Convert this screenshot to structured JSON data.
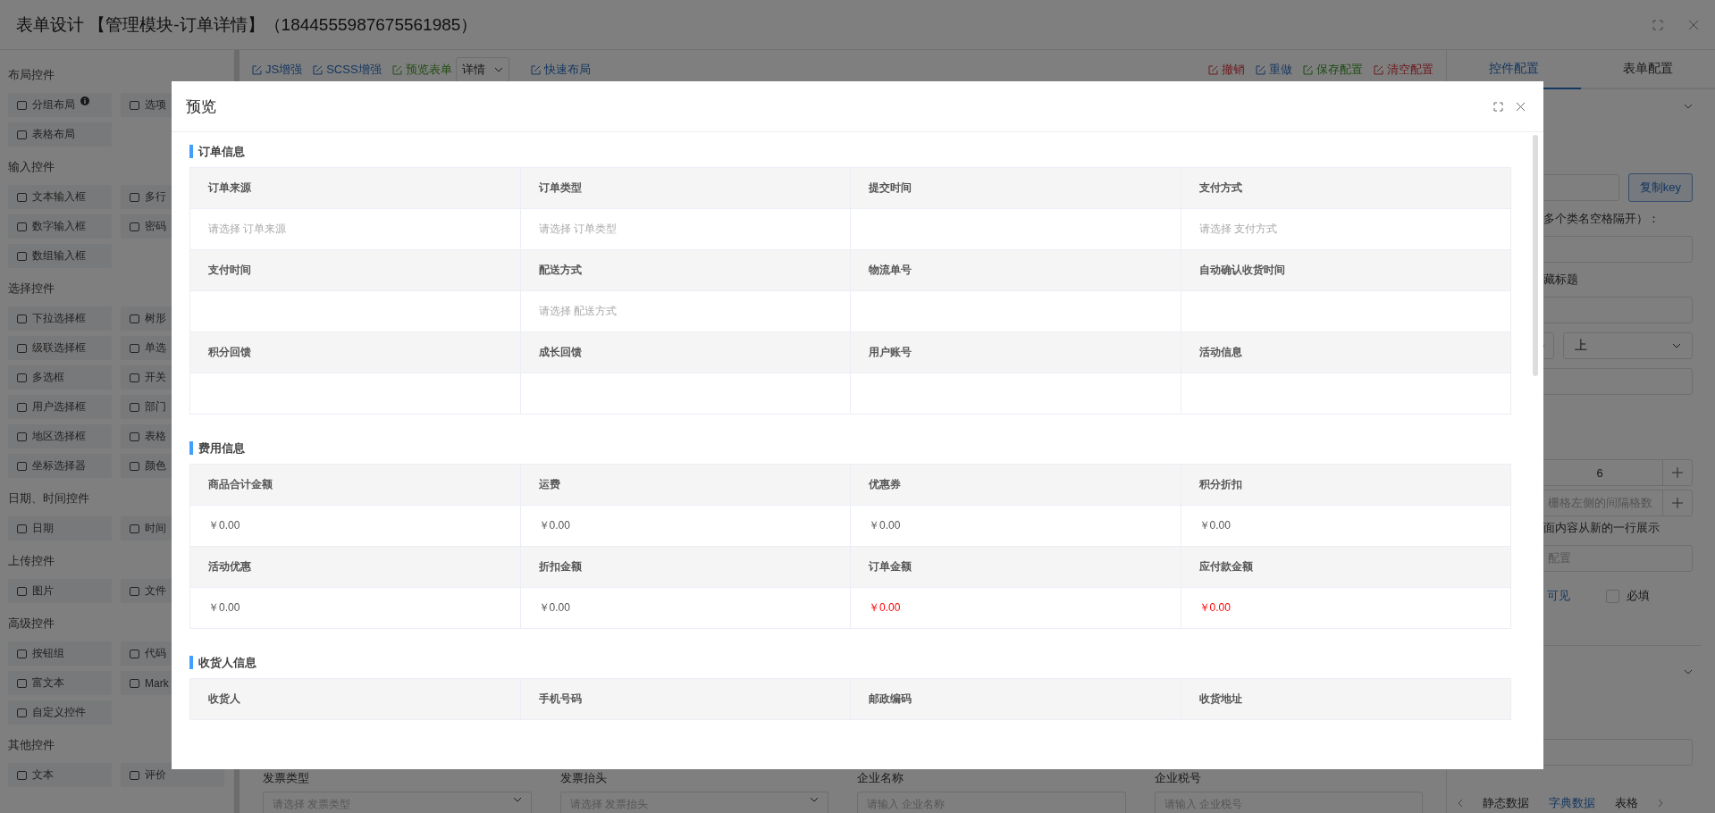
{
  "window": {
    "title": "表单设计 【管理模块-订单详情】（1844555987675561985）"
  },
  "sidebar": {
    "groups": [
      {
        "title": "布局控件",
        "items": [
          {
            "label": "分组布局",
            "info": true
          },
          {
            "label": "选项"
          },
          {
            "label": "表格布局"
          }
        ]
      },
      {
        "title": "输入控件",
        "items": [
          {
            "label": "文本输入框"
          },
          {
            "label": "多行"
          },
          {
            "label": "数字输入框"
          },
          {
            "label": "密码"
          },
          {
            "label": "数组输入框"
          }
        ]
      },
      {
        "title": "选择控件",
        "items": [
          {
            "label": "下拉选择框"
          },
          {
            "label": "树形"
          },
          {
            "label": "级联选择框"
          },
          {
            "label": "单选"
          },
          {
            "label": "多选框"
          },
          {
            "label": "开关"
          },
          {
            "label": "用户选择框"
          },
          {
            "label": "部门"
          },
          {
            "label": "地区选择框"
          },
          {
            "label": "表格"
          },
          {
            "label": "坐标选择器"
          },
          {
            "label": "颜色"
          }
        ]
      },
      {
        "title": "日期、时间控件",
        "items": [
          {
            "label": "日期"
          },
          {
            "label": "时间"
          }
        ]
      },
      {
        "title": "上传控件",
        "items": [
          {
            "label": "图片"
          },
          {
            "label": "文件"
          }
        ]
      },
      {
        "title": "高级控件",
        "items": [
          {
            "label": "按钮组"
          },
          {
            "label": "代码"
          },
          {
            "label": "富文本"
          },
          {
            "label": "Mark"
          },
          {
            "label": "自定义控件"
          }
        ]
      },
      {
        "title": "其他控件",
        "items": [
          {
            "label": "文本"
          },
          {
            "label": "评价"
          }
        ]
      }
    ]
  },
  "toolbar": {
    "left": [
      {
        "label": "JS增强",
        "kind": "link"
      },
      {
        "label": "SCSS增强",
        "kind": "link"
      },
      {
        "label": "预览表单",
        "kind": "preview"
      },
      {
        "label": "详情",
        "kind": "select"
      },
      {
        "label": "快速布局",
        "kind": "link"
      }
    ],
    "right": [
      {
        "label": "撤销",
        "kind": "danger"
      },
      {
        "label": "重做",
        "kind": "link"
      },
      {
        "label": "保存配置",
        "kind": "success"
      },
      {
        "label": "清空配置",
        "kind": "danger"
      }
    ]
  },
  "canvas_fields": [
    {
      "label": "发票类型",
      "placeholder": "请选择 发票类型",
      "kind": "select"
    },
    {
      "label": "发票抬头",
      "placeholder": "请选择 发票抬头",
      "kind": "select"
    },
    {
      "label": "企业名称",
      "placeholder": "请输入 企业名称",
      "kind": "input"
    },
    {
      "label": "企业税号",
      "placeholder": "请输入 企业税号",
      "kind": "input"
    }
  ],
  "right_panel": {
    "tabs": [
      {
        "label": "控件配置",
        "selected": true
      },
      {
        "label": "表单配置",
        "selected": false
      }
    ],
    "copy_button": "复制key",
    "class_hint": "多个类名空格隔开）：",
    "hide_title_label": "藏标题",
    "position_select": "上",
    "span_value": "6",
    "offset_placeholder": "栅格左侧的间隔格数",
    "newline_label": "面内容从新的一行展示",
    "validate_placeholder": "配置",
    "checks": [
      {
        "label": "可见",
        "checked": true
      },
      {
        "label": "必填",
        "checked": false
      }
    ],
    "data_tabs": [
      {
        "label": "静态数据",
        "selected": false
      },
      {
        "label": "字典数据",
        "selected": true
      },
      {
        "label": "表格",
        "selected": false
      }
    ]
  },
  "modal": {
    "title": "预览",
    "sections": [
      {
        "title": "订单信息",
        "fields": [
          {
            "label": "订单来源",
            "placeholder": "请选择 订单来源"
          },
          {
            "label": "订单类型",
            "placeholder": "请选择 订单类型"
          },
          {
            "label": "提交时间"
          },
          {
            "label": "支付方式",
            "placeholder": "请选择 支付方式"
          },
          {
            "label": "支付时间"
          },
          {
            "label": "配送方式",
            "placeholder": "请选择 配送方式"
          },
          {
            "label": "物流单号"
          },
          {
            "label": "自动确认收货时间"
          },
          {
            "label": "积分回馈"
          },
          {
            "label": "成长回馈"
          },
          {
            "label": "用户账号"
          },
          {
            "label": "活动信息"
          }
        ]
      },
      {
        "title": "费用信息",
        "fields": [
          {
            "label": "商品合计金额",
            "value": "￥0.00",
            "warning": false
          },
          {
            "label": "运费",
            "value": "￥0.00",
            "warning": false
          },
          {
            "label": "优惠券",
            "value": "￥0.00",
            "warning": false
          },
          {
            "label": "积分折扣",
            "value": "￥0.00",
            "warning": false
          },
          {
            "label": "活动优惠",
            "value": "￥0.00",
            "warning": false
          },
          {
            "label": "折扣金额",
            "value": "￥0.00",
            "warning": false
          },
          {
            "label": "订单金额",
            "value": "￥0.00",
            "warning": true
          },
          {
            "label": "应付款金额",
            "value": "￥0.00",
            "warning": true
          }
        ]
      },
      {
        "title": "收货人信息",
        "header_only": true,
        "fields": [
          {
            "label": "收货人"
          },
          {
            "label": "手机号码"
          },
          {
            "label": "邮政编码"
          },
          {
            "label": "收货地址"
          }
        ]
      }
    ]
  }
}
